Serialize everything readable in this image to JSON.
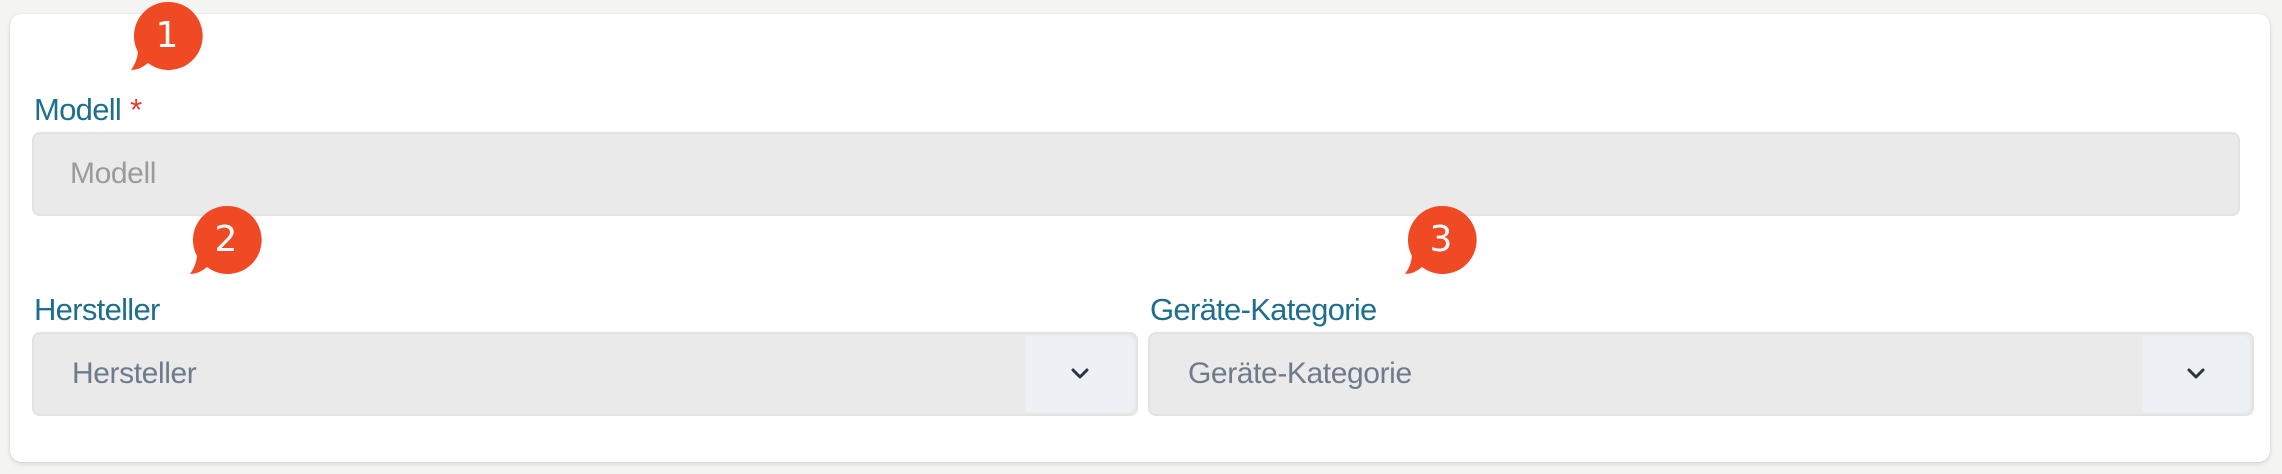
{
  "form": {
    "model": {
      "label": "Modell",
      "required_marker": "*",
      "placeholder": "Modell"
    },
    "manufacturer": {
      "label": "Hersteller",
      "placeholder": "Hersteller",
      "dropdown_icon": "chevron-down-icon"
    },
    "category": {
      "label": "Geräte-Kategorie",
      "placeholder": "Geräte-Kategorie",
      "dropdown_icon": "chevron-down-icon"
    }
  },
  "callouts": [
    "1",
    "2",
    "3"
  ],
  "colors": {
    "label": "#1e6f8e",
    "required": "#e23b2e",
    "callout": "#f04a24",
    "field_bg": "#eaeaea",
    "placeholder": "#9b9b9b",
    "select_text": "#6f7b8a"
  }
}
